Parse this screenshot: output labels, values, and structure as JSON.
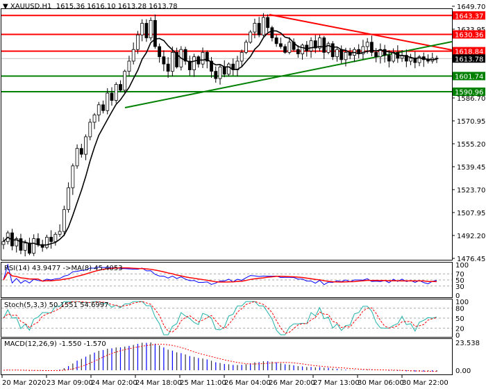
{
  "header": {
    "symbol": "XAUUSD,H1",
    "ohlc": "1615.36 1616.10 1613.28 1613.78"
  },
  "price_axis": {
    "ticks": [
      "1649.70",
      "1633.95",
      "1586.70",
      "1570.95",
      "1555.20",
      "1539.45",
      "1523.70",
      "1507.95",
      "1492.20",
      "1476.45"
    ],
    "tick_values": [
      1649.7,
      1633.95,
      1586.7,
      1570.95,
      1555.2,
      1539.45,
      1523.7,
      1507.95,
      1492.2,
      1476.45
    ]
  },
  "levels": [
    {
      "label": "1643.37",
      "value": 1643.37,
      "color": "#ff0000"
    },
    {
      "label": "1630.36",
      "value": 1630.36,
      "color": "#ff0000"
    },
    {
      "label": "1618.84",
      "value": 1618.84,
      "color": "#ff0000"
    },
    {
      "label": "1613.78",
      "value": 1613.78,
      "color": "#000000"
    },
    {
      "label": "1601.74",
      "value": 1601.74,
      "color": "#008000"
    },
    {
      "label": "1590.96",
      "value": 1590.96,
      "color": "#008000"
    }
  ],
  "closes": [
    1488,
    1494,
    1485,
    1490,
    1482,
    1487,
    1480,
    1490,
    1486,
    1484,
    1491,
    1488,
    1493,
    1495,
    1510,
    1525,
    1540,
    1552,
    1548,
    1560,
    1570,
    1575,
    1582,
    1578,
    1590,
    1585,
    1596,
    1592,
    1605,
    1612,
    1620,
    1630,
    1638,
    1628,
    1640,
    1622,
    1615,
    1610,
    1605,
    1618,
    1608,
    1620,
    1612,
    1606,
    1615,
    1610,
    1618,
    1612,
    1605,
    1600,
    1608,
    1603,
    1610,
    1606,
    1612,
    1618,
    1625,
    1632,
    1638,
    1630,
    1642,
    1635,
    1628,
    1624,
    1622,
    1618,
    1625,
    1620,
    1617,
    1623,
    1619,
    1626,
    1621,
    1628,
    1618,
    1624,
    1615,
    1620,
    1613,
    1618,
    1616,
    1620,
    1617,
    1622,
    1625,
    1618,
    1615,
    1620,
    1616,
    1612,
    1618,
    1614,
    1616,
    1612,
    1614,
    1611,
    1615,
    1613,
    1612,
    1614,
    1613.78
  ],
  "rsi": {
    "label": "RSI(14) 43.9477  ->MA(8) 45.4053",
    "ticks": [
      "100",
      "70",
      "50",
      "30",
      "0"
    ]
  },
  "stoch": {
    "label": "Stoch(5,3,3) 50.1551 54.6997",
    "ticks": [
      "100",
      "80",
      "50",
      "20",
      "0"
    ]
  },
  "macd": {
    "label": "MACD(12,26,9) -1.550 -1.570",
    "ticks": [
      "23.538",
      "0.00"
    ]
  },
  "time_axis": [
    "20 Mar 2020",
    "23 Mar 09:00",
    "24 Mar 02:00",
    "24 Mar 18:00",
    "25 Mar 11:00",
    "26 Mar 04:00",
    "26 Mar 20:00",
    "27 Mar 13:00",
    "30 Mar 06:00",
    "30 Mar 22:00"
  ]
}
